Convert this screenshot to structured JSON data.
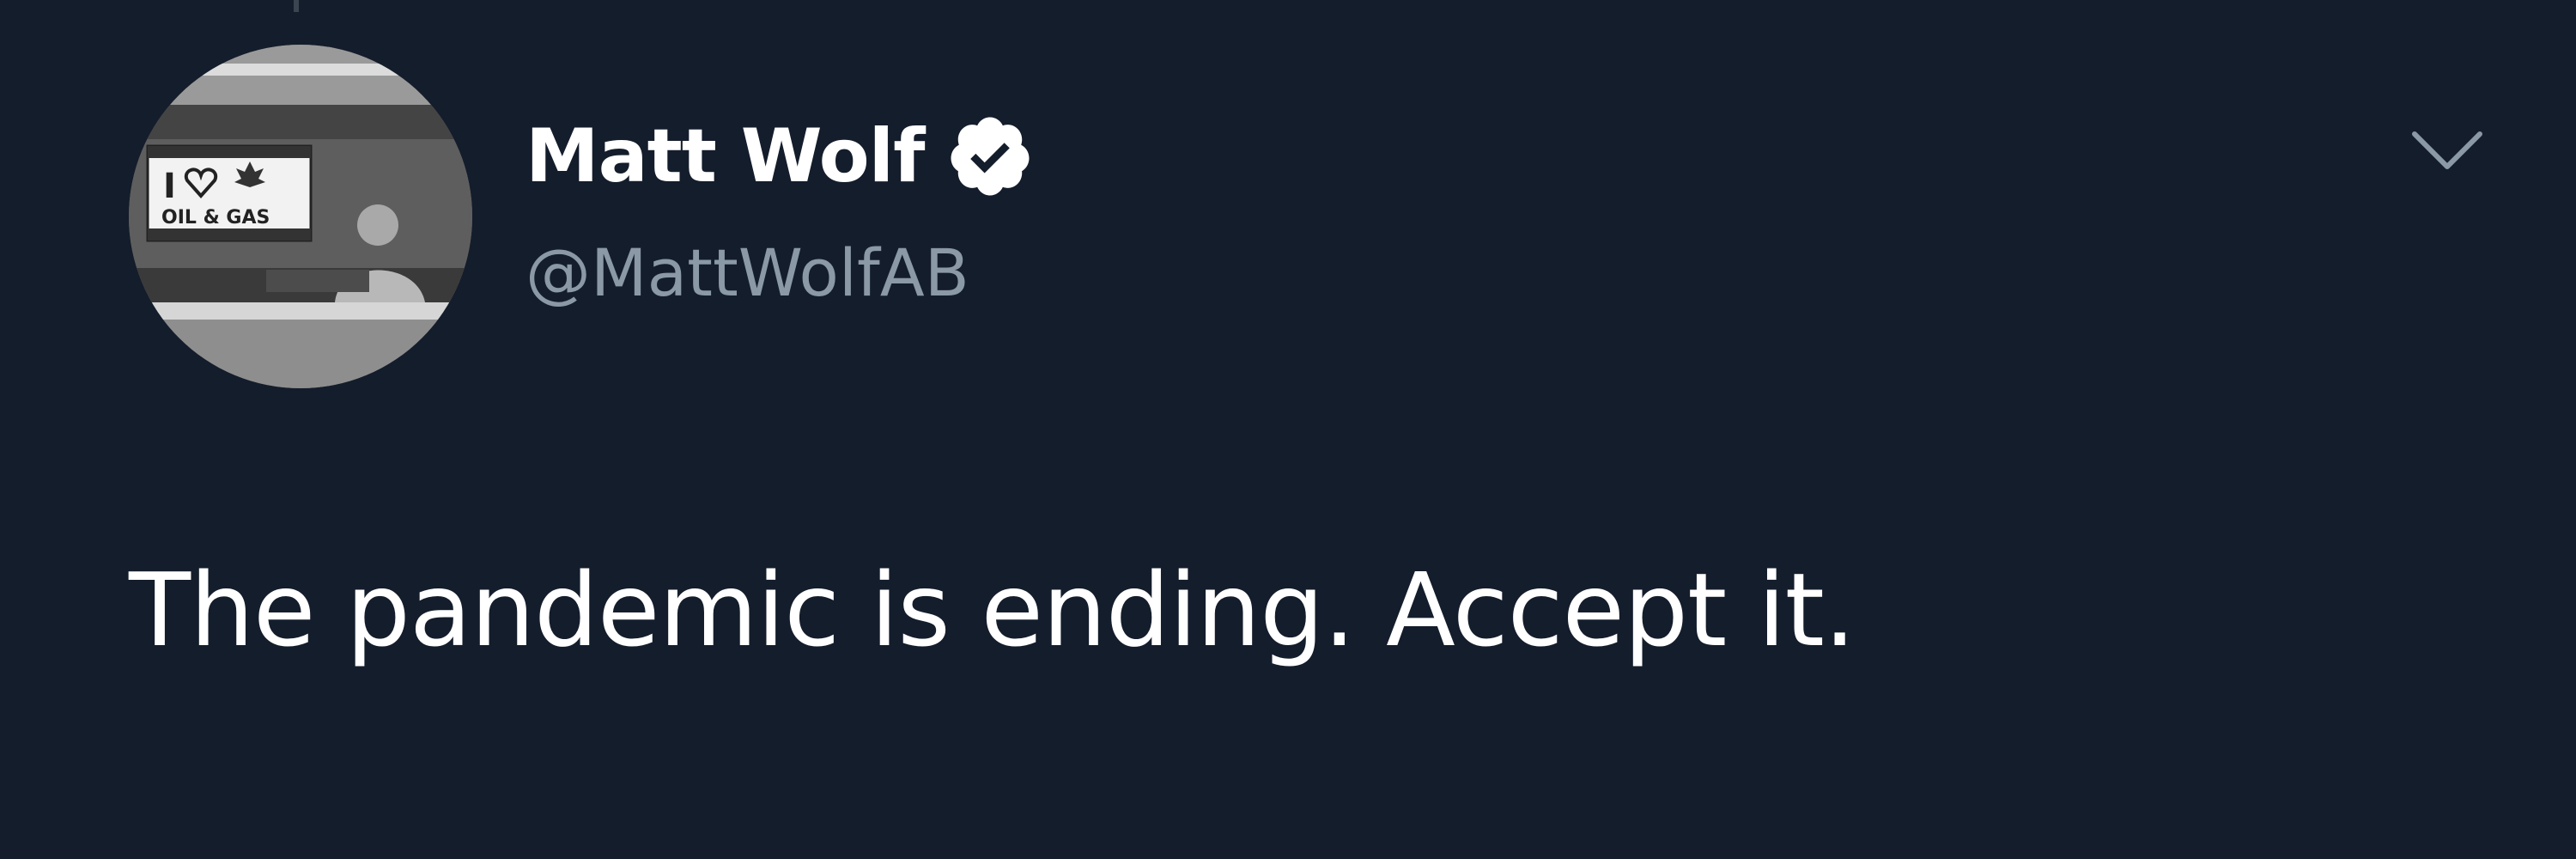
{
  "tweet": {
    "author": {
      "display_name": "Matt Wolf",
      "handle": "@MattWolfAB",
      "verified": true,
      "avatar_icon": "profile-photo-oil-gas-sign"
    },
    "text": "The pandemic is ending. Accept it.",
    "menu_icon": "chevron-down-icon"
  },
  "avatar_sign": {
    "line1": "I",
    "line2": "OIL & GAS"
  },
  "colors": {
    "background": "#141d2b",
    "primary_text": "#ffffff",
    "secondary_text": "#8b98a5"
  }
}
